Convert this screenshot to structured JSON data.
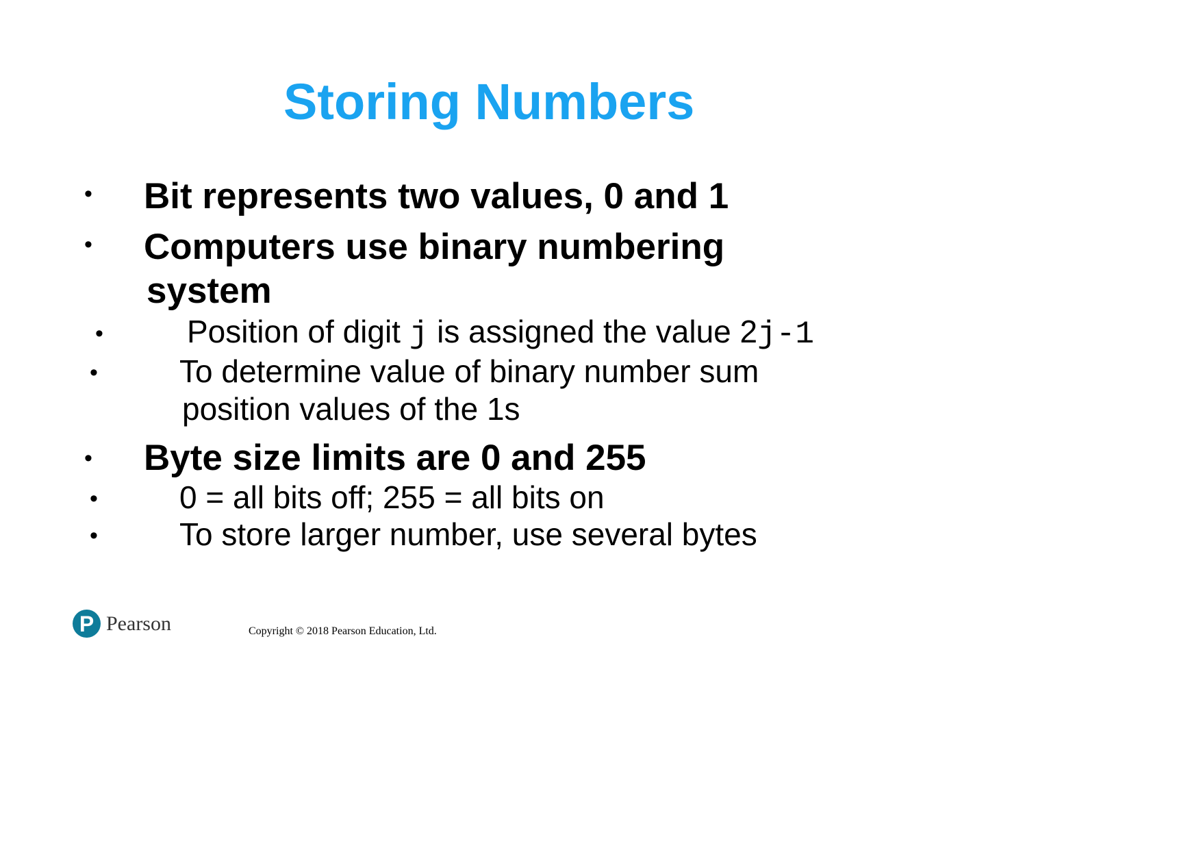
{
  "slide": {
    "title": "Storing Numbers",
    "title_color": "#1aa3f0",
    "bullet_symbol": "•",
    "items": [
      {
        "text": "Bit represents two values, 0 and 1"
      },
      {
        "line1": "Computers use binary numbering",
        "line2": "system"
      },
      {
        "prefix": "Position of digit ",
        "var": "j",
        "middle": " is assigned the value 2",
        "exponent": "j-1"
      },
      {
        "line1": "To determine value of binary number sum",
        "line2": "position values of the 1s"
      },
      {
        "text": "Byte size limits are 0 and 255"
      },
      {
        "text": "0 = all bits off; 255 = all bits on"
      },
      {
        "text": "To store larger number, use several bytes"
      }
    ]
  },
  "footer": {
    "logo_icon": "pearson-logo-icon",
    "logo_text": "Pearson",
    "logo_color": "#0e7c9a",
    "copyright": "Copyright © 2018 Pearson Education, Ltd."
  }
}
